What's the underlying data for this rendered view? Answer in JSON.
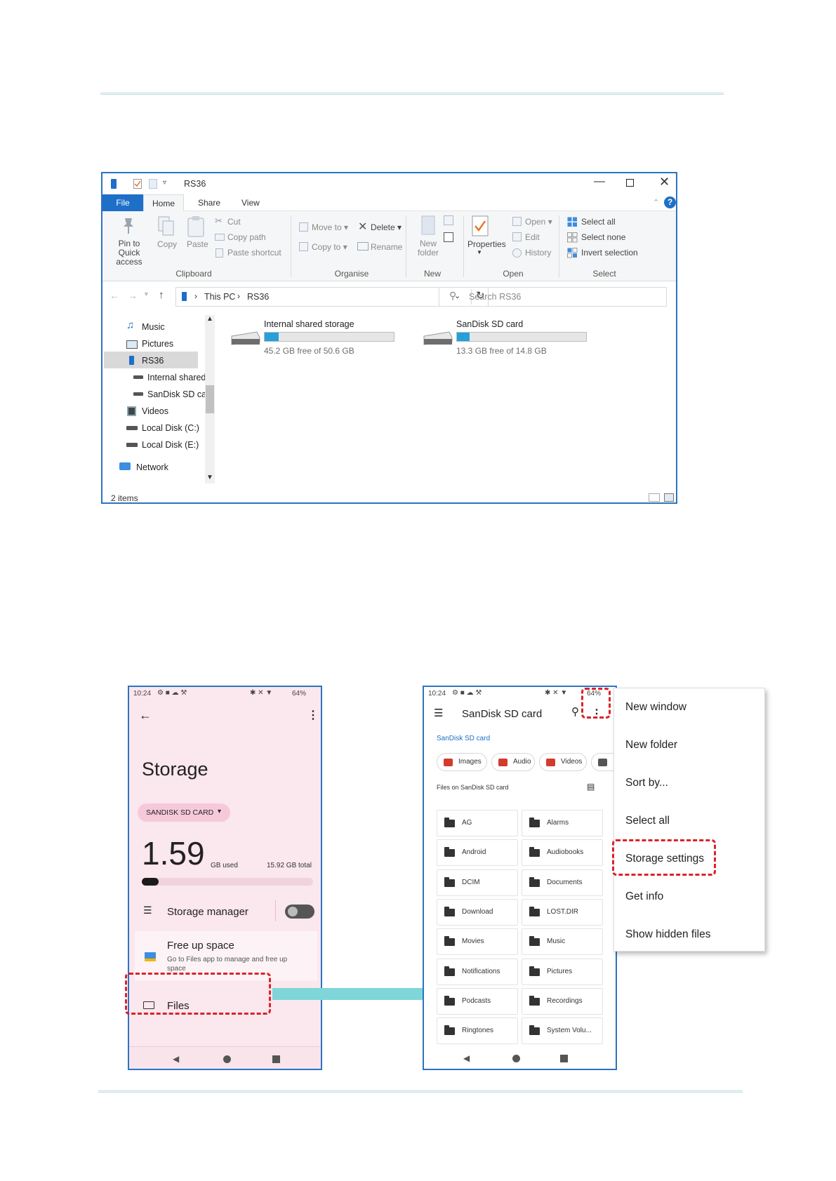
{
  "explorer": {
    "title": "RS36",
    "tabs": [
      "File",
      "Home",
      "Share",
      "View"
    ],
    "ribbon": {
      "pin": "Pin to Quick access",
      "copy": "Copy",
      "paste": "Paste",
      "cut": "Cut",
      "copy_path": "Copy path",
      "paste_shortcut": "Paste shortcut",
      "move_to": "Move to",
      "copy_to": "Copy to",
      "delete": "Delete",
      "rename": "Rename",
      "new_folder_line1": "New",
      "new_folder_line2": "folder",
      "properties": "Properties",
      "open": "Open",
      "edit": "Edit",
      "history": "History",
      "select_all": "Select all",
      "select_none": "Select none",
      "invert_selection": "Invert selection",
      "groups": [
        "Clipboard",
        "Organise",
        "New",
        "Open",
        "Select"
      ]
    },
    "breadcrumb": [
      "This PC",
      "RS36"
    ],
    "search_placeholder": "Search RS36",
    "nav": [
      "Music",
      "Pictures",
      "RS36",
      "Internal shared",
      "SanDisk SD car",
      "Videos",
      "Local Disk (C:)",
      "Local Disk (E:)",
      "Network"
    ],
    "drives": [
      {
        "name": "Internal shared storage",
        "free": "45.2 GB free of 50.6 GB",
        "used_fraction": 0.11
      },
      {
        "name": "SanDisk SD card",
        "free": "13.3 GB free of 14.8 GB",
        "used_fraction": 0.1
      }
    ],
    "status": "2 items"
  },
  "phone1": {
    "status_time": "10:24",
    "battery": "64%",
    "title": "Storage",
    "storage_chip": "SANDISK SD CARD",
    "used_value": "1.59",
    "used_unit": "GB used",
    "total": "15.92 GB total",
    "used_fraction": 0.1,
    "storage_manager": "Storage manager",
    "free_up_title": "Free up space",
    "free_up_desc": "Go to Files app to manage and free up space",
    "files": "Files"
  },
  "phone2": {
    "status_time": "10:24",
    "battery": "64%",
    "title": "SanDisk SD card",
    "breadcrumb": "SanDisk SD card",
    "chips": [
      "Images",
      "Audio",
      "Videos"
    ],
    "section": "Files on SanDisk SD card",
    "folders": [
      "AG",
      "Alarms",
      "Android",
      "Audiobooks",
      "DCIM",
      "Documents",
      "Download",
      "LOST.DIR",
      "Movies",
      "Music",
      "Notifications",
      "Pictures",
      "Podcasts",
      "Recordings",
      "Ringtones",
      "System Volu..."
    ]
  },
  "menu": [
    "New window",
    "New folder",
    "Sort by...",
    "Select all",
    "Storage settings",
    "Get info",
    "Show hidden files"
  ],
  "colors": {
    "accent": "#2b73c3",
    "highlight": "#d8232a",
    "arrow": "#7fd6d9",
    "phone_bg": "#fbe7ee"
  }
}
